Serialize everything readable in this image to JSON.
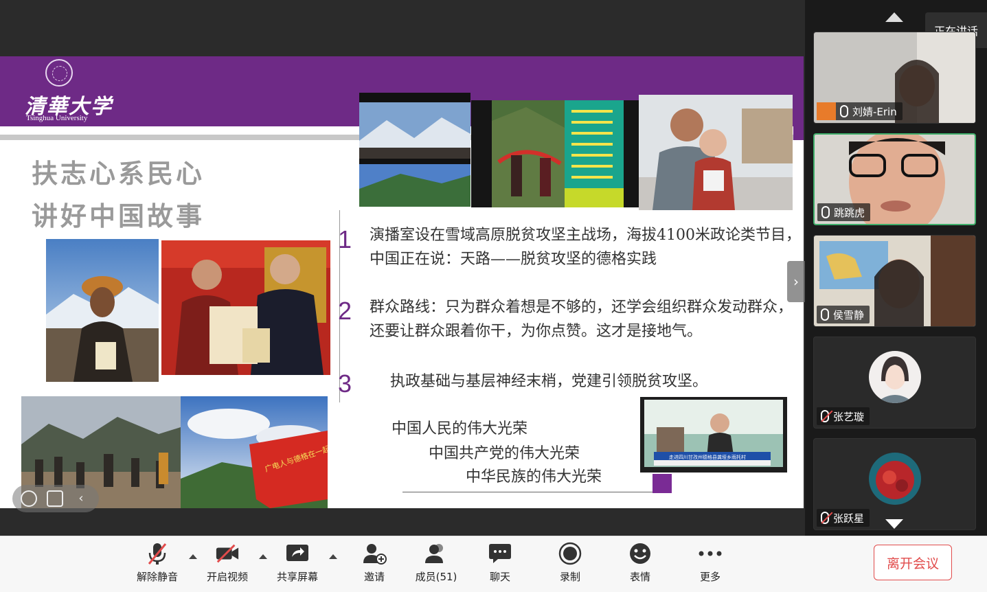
{
  "slide": {
    "logo_cn": "清華大学",
    "logo_en": "Tsinghua University",
    "title_line1": "扶志心系民心",
    "title_line2": "讲好中国故事",
    "points": [
      {
        "num": "1",
        "text": "演播室设在雪域高原脱贫攻坚主战场，海拔4100米政论类节目，中国正在说：天路——脱贫攻坚的德格实践"
      },
      {
        "num": "2",
        "text": "群众路线：只为群众着想是不够的，还学会组织群众发动群众，还要让群众跟着你干，为你点赞。这才是接地气。"
      },
      {
        "num": "3",
        "text": "执政基础与基层神经末梢，党建引领脱贫攻坚。"
      }
    ],
    "slogans": [
      "中国人民的伟大光荣",
      "中国共产党的伟大光荣",
      "中华民族的伟大光荣"
    ],
    "banner_text": "广电人与德格在一起",
    "tv_caption": "走进四川甘孜州德格县龚垭乡雨托村"
  },
  "side_panel": {
    "speaking_label": "正在讲话",
    "participants": [
      {
        "name": "刘婧-Erin",
        "muted": false
      },
      {
        "name": "跳跳虎",
        "muted": false
      },
      {
        "name": "侯雪静",
        "muted": false
      },
      {
        "name": "张艺璇",
        "muted": true
      },
      {
        "name": "张跃星",
        "muted": true
      }
    ]
  },
  "toolbar": {
    "unmute": "解除静音",
    "start_video": "开启视频",
    "share_screen": "共享屏幕",
    "invite": "邀请",
    "members": "成员(51)",
    "chat": "聊天",
    "record": "录制",
    "reactions": "表情",
    "more": "更多",
    "leave": "离开会议"
  },
  "colors": {
    "brand_purple": "#6e2a86",
    "leave_red": "#e14b4b",
    "active_speaker": "#3fae6a"
  }
}
